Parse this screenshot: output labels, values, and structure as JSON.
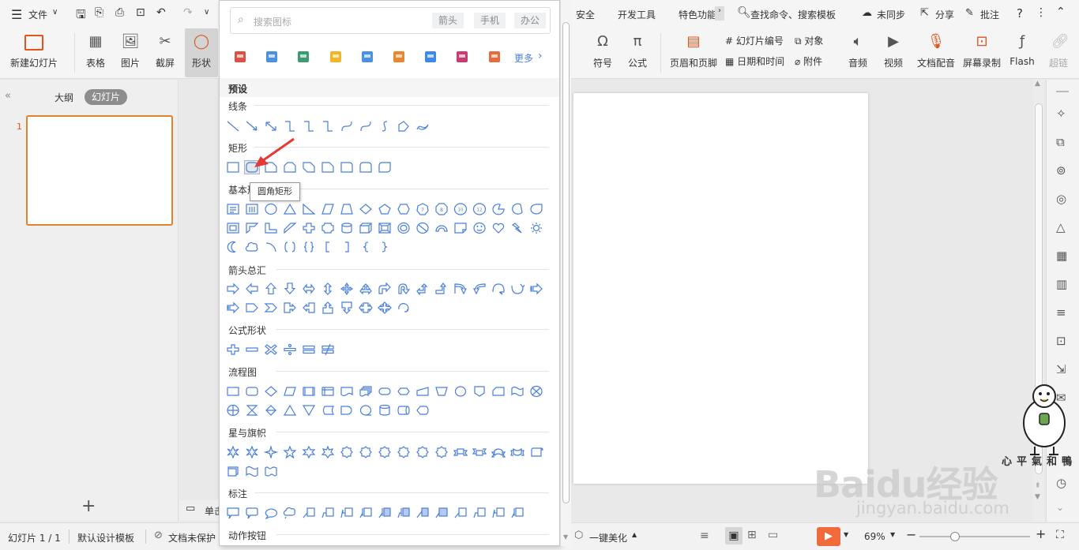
{
  "menubar": {
    "file": "文件",
    "tabs_right": [
      "安全",
      "开发工具",
      "特色功能"
    ],
    "search": "查找命令、搜索模板",
    "sync": "未同步",
    "share": "分享",
    "comment": "批注",
    "help": "?"
  },
  "ribbon": {
    "left": [
      "新建幻灯片",
      "表格",
      "图片",
      "截屏",
      "形状"
    ],
    "right_big": [
      "符号",
      "公式",
      "页眉和页脚",
      "音频",
      "视频",
      "文档配音",
      "屏幕录制",
      "Flash",
      "超链"
    ],
    "right_small": [
      "幻灯片编号",
      "对象",
      "日期和时间",
      "附件"
    ]
  },
  "leftpanel": {
    "tab_outline": "大纲",
    "tab_slides": "幻灯片",
    "slide_number": "1",
    "add": "+"
  },
  "statusbar": {
    "slide_info": "幻灯片 1 / 1",
    "design": "默认设计模板",
    "protect": "文档未保护",
    "beautify": "一键美化",
    "zoom": "69%",
    "notes_prefix": "单击"
  },
  "dropdown": {
    "search_placeholder": "搜索图标",
    "search_tags": [
      "箭头",
      "手机",
      "办公"
    ],
    "more": "更多",
    "preset": "预设",
    "sections": [
      "线条",
      "矩形",
      "基本形状",
      "箭头总汇",
      "公式形状",
      "流程图",
      "星与旗帜",
      "标注",
      "动作按钮"
    ],
    "tooltip": "圆角矩形"
  },
  "watermark": {
    "brand": "Baidu经验",
    "url": "jingyan.baidu.com",
    "signature": "心平氣和鴨"
  },
  "colors": {
    "accent": "#e0531a",
    "shape_stroke": "#4a7fd6",
    "play": "#f06a3b",
    "arrow": "#e53935"
  }
}
